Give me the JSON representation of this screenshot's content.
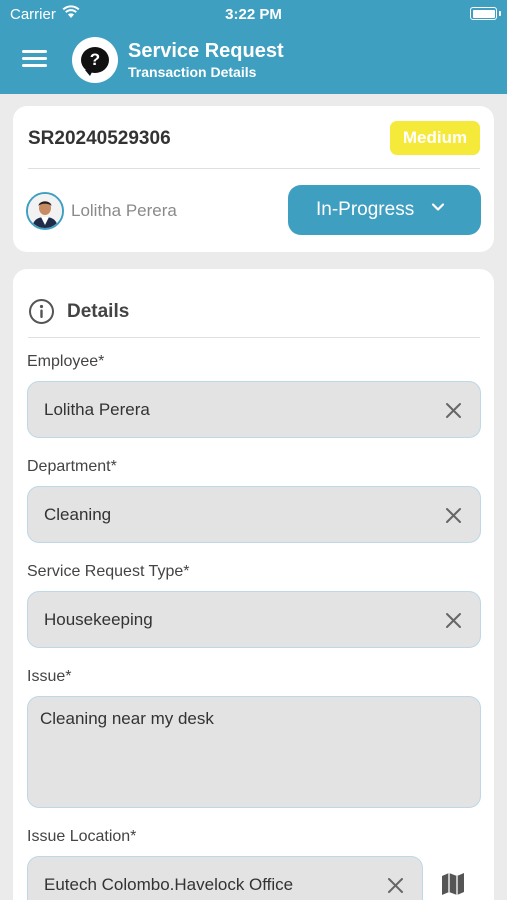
{
  "status_bar": {
    "carrier": "Carrier",
    "time": "3:22 PM"
  },
  "header": {
    "title": "Service Request",
    "subtitle": "Transaction Details",
    "logo_glyph": "?"
  },
  "summary": {
    "sr_number": "SR20240529306",
    "priority": "Medium",
    "assignee": "Lolitha Perera",
    "status": "In-Progress"
  },
  "details": {
    "section_title": "Details",
    "employee": {
      "label": "Employee*",
      "value": "Lolitha Perera"
    },
    "department": {
      "label": "Department*",
      "value": "Cleaning"
    },
    "request_type": {
      "label": "Service Request Type*",
      "value": "Housekeeping"
    },
    "issue": {
      "label": "Issue*",
      "value": "Cleaning near my desk"
    },
    "location": {
      "label": "Issue Location*",
      "value": "Eutech Colombo.Havelock Office"
    }
  },
  "colors": {
    "primary": "#3f9fc1",
    "priority": "#f5e93a",
    "field_bg": "#e3e3e3"
  }
}
